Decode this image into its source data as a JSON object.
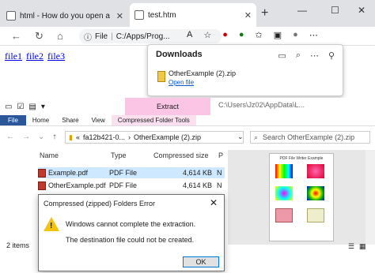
{
  "browser": {
    "tabs": [
      {
        "title": "html - How do you open a zipped"
      },
      {
        "title": "test.htm"
      }
    ],
    "address_scheme": "File",
    "address_path": "C:/Apps/Prog...",
    "colors": {
      "tabstrip": "#dfe1e5",
      "active_tab": "#ffffff"
    }
  },
  "page_links": [
    "file1",
    "file2",
    "file3"
  ],
  "downloads": {
    "title": "Downloads",
    "file_name": "OtherExample (2).zip",
    "open_link": "Open file"
  },
  "explorer": {
    "extract_tab": "Extract",
    "path_text": "C:\\Users\\Jz02\\AppData\\L...",
    "ribbon_tabs": [
      "File",
      "Home",
      "Share",
      "View",
      "Compressed Folder Tools"
    ],
    "breadcrumb": [
      "«",
      "fa12b421-0...",
      "›",
      "OtherExample (2).zip"
    ],
    "search_placeholder": "Search OtherExample (2).zip",
    "columns": [
      "Name",
      "Type",
      "Compressed size",
      "P"
    ],
    "files": [
      {
        "name": "Example.pdf",
        "type": "PDF File",
        "size": "4,614 KB",
        "p": "N"
      },
      {
        "name": "OtherExample.pdf",
        "type": "PDF File",
        "size": "4,614 KB",
        "p": "N"
      }
    ],
    "status": "2 items",
    "preview_title": "PDF File Writer Example"
  },
  "dialog": {
    "title": "Compressed (zipped) Folders Error",
    "message1": "Windows cannot complete the extraction.",
    "message2": "The destination file could not be created.",
    "ok": "OK"
  }
}
